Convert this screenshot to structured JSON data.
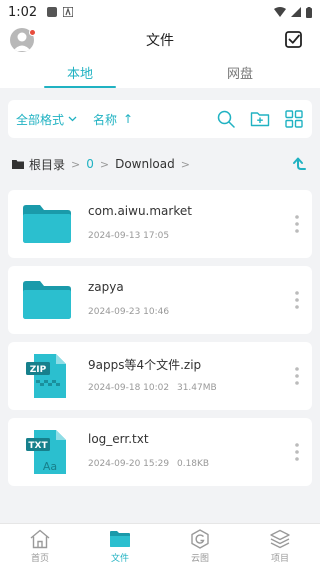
{
  "status_bar": {
    "time": "1:02"
  },
  "header": {
    "title": "文件"
  },
  "tabs": [
    {
      "label": "本地",
      "active": true
    },
    {
      "label": "网盘",
      "active": false
    }
  ],
  "toolbar": {
    "format_label": "全部格式",
    "sort_label": "名称",
    "sort_direction": "↑",
    "icons": [
      "search-icon",
      "new-folder-icon",
      "grid-view-icon"
    ]
  },
  "breadcrumb": {
    "root": "根目录",
    "level1": "0",
    "level2": "Download"
  },
  "files": [
    {
      "name": "com.aiwu.market",
      "date": "2024-09-13 17:05",
      "size": "",
      "type": "folder"
    },
    {
      "name": "zapya",
      "date": "2024-09-23 10:46",
      "size": "",
      "type": "folder"
    },
    {
      "name": "9apps等4个文件.zip",
      "date": "2024-09-18 10:02",
      "size": "31.47MB",
      "type": "zip",
      "badge": "ZIP"
    },
    {
      "name": "log_err.txt",
      "date": "2024-09-20 15:29",
      "size": "0.18KB",
      "type": "txt",
      "badge": "TXT",
      "glyph": "Aa"
    }
  ],
  "bottom_nav": [
    {
      "label": "首页",
      "icon": "home-icon",
      "active": false
    },
    {
      "label": "文件",
      "icon": "folder-icon",
      "active": true
    },
    {
      "label": "云图",
      "icon": "cloud-image-icon",
      "active": false
    },
    {
      "label": "项目",
      "icon": "layers-icon",
      "active": false
    }
  ],
  "colors": {
    "accent": "#20b2c2",
    "background": "#f2f3f5",
    "folder": "#2bbfcf"
  }
}
